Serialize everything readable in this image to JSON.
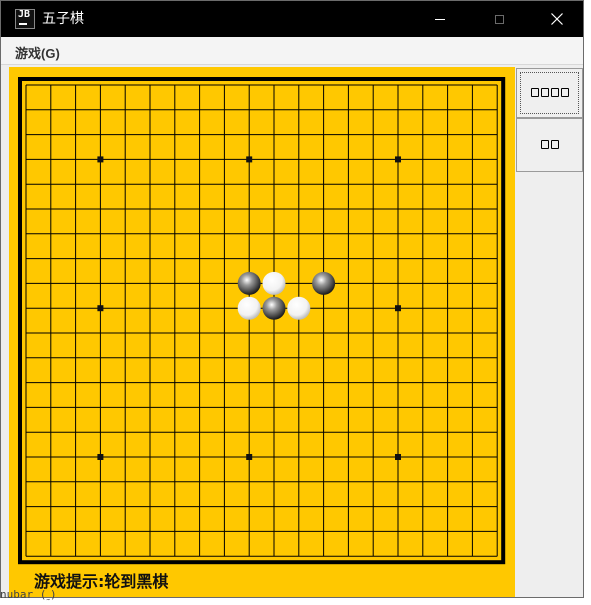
{
  "window": {
    "title": "五子棋",
    "icon": "jetbrains-app-icon",
    "icon_text": "JB",
    "controls": [
      "minimize-icon",
      "maximize-icon",
      "close-icon"
    ]
  },
  "menubar": {
    "items": [
      {
        "label": "游戏(G)"
      }
    ]
  },
  "board": {
    "lines": 20,
    "background_color": "#ffc800",
    "line_color": "#000000",
    "star_points": [
      [
        3,
        3
      ],
      [
        9,
        3
      ],
      [
        15,
        3
      ],
      [
        3,
        9
      ],
      [
        15,
        9
      ],
      [
        3,
        15
      ],
      [
        9,
        15
      ],
      [
        15,
        15
      ]
    ],
    "stones": [
      {
        "col": 9,
        "row": 8,
        "color": "black"
      },
      {
        "col": 10,
        "row": 8,
        "color": "white"
      },
      {
        "col": 12,
        "row": 8,
        "color": "black"
      },
      {
        "col": 9,
        "row": 9,
        "color": "white"
      },
      {
        "col": 10,
        "row": 9,
        "color": "black"
      },
      {
        "col": 11,
        "row": 9,
        "color": "white"
      }
    ]
  },
  "status": {
    "text": "游戏提示:轮到黑棋"
  },
  "side_buttons": [
    {
      "label": "□□□□",
      "boxes": 4
    },
    {
      "label": "□□",
      "boxes": 2
    }
  ],
  "background_app": {
    "partial_text": "nubar (˷)"
  }
}
